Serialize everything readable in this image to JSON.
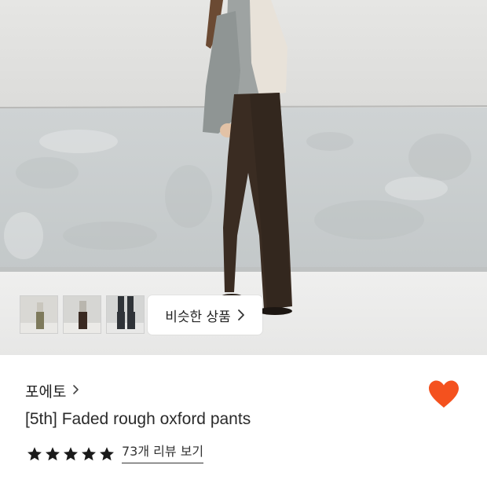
{
  "hero": {
    "image": "model-wearing-brown-wide-oxford-pants",
    "thumbnails": [
      {
        "name": "thumbnail-1",
        "pants_color": "#7e7a5c"
      },
      {
        "name": "thumbnail-2",
        "pants_color": "#3a2a22"
      },
      {
        "name": "thumbnail-3",
        "pants_color": "#2f3338"
      }
    ],
    "similar_button": {
      "label": "비슷한 상품",
      "icon": "chevron-right-icon"
    }
  },
  "product": {
    "brand": "포에토",
    "brand_icon": "chevron-right-icon",
    "title": "[5th] Faded rough oxford pants",
    "rating": {
      "stars": 5,
      "max": 5
    },
    "review_link": "73개 리뷰 보기",
    "wishlist": {
      "icon": "heart-icon",
      "active": true,
      "color": "#f4511e"
    }
  }
}
